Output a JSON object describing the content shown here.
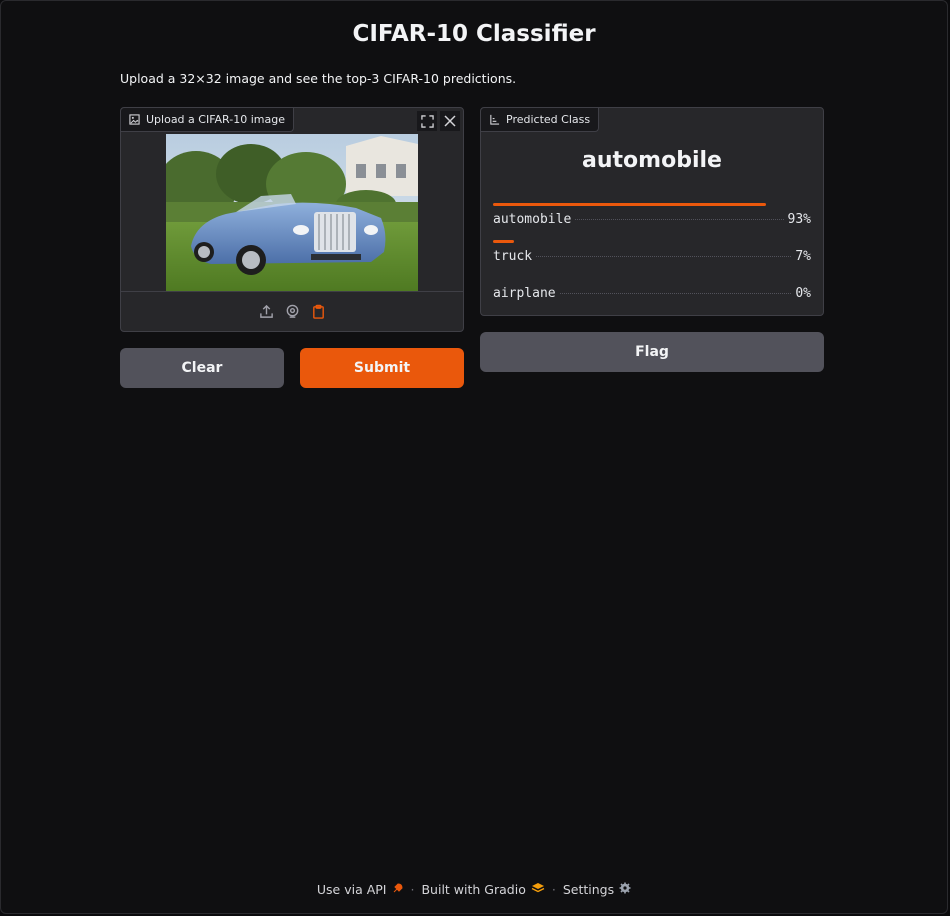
{
  "header": {
    "title": "CIFAR-10 Classifier",
    "description": "Upload a 32×32 image and see the top-3 CIFAR-10 predictions."
  },
  "input_panel": {
    "label": "Upload a CIFAR-10 image",
    "image_alt": "blue convertible car on grass"
  },
  "buttons": {
    "clear": "Clear",
    "submit": "Submit",
    "flag": "Flag"
  },
  "output_panel": {
    "label": "Predicted Class",
    "predicted": "automobile",
    "confidences": [
      {
        "label": "automobile",
        "value": "93%",
        "fraction": 0.93
      },
      {
        "label": "truck",
        "value": "7%",
        "fraction": 0.07
      },
      {
        "label": "airplane",
        "value": "0%",
        "fraction": 0.0
      }
    ]
  },
  "footer": {
    "api": "Use via API",
    "sep": "·",
    "built": "Built with Gradio",
    "settings": "Settings"
  },
  "colors": {
    "accent": "#ea580c",
    "secondary_button": "#52525b",
    "background": "#0f0f11",
    "panel": "#27272a"
  },
  "icons": [
    "image-icon",
    "fullscreen-icon",
    "close-icon",
    "upload-icon",
    "webcam-icon",
    "clipboard-icon",
    "label-icon",
    "rocket-icon",
    "gradio-logo-icon",
    "gear-icon"
  ]
}
